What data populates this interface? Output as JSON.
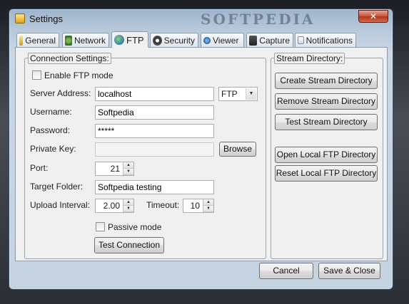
{
  "window": {
    "title": "Settings",
    "watermark": "SOFTPEDIA",
    "close_glyph": "✕"
  },
  "tabs": [
    {
      "label": "General",
      "icon": "general-icon"
    },
    {
      "label": "Network",
      "icon": "network-icon"
    },
    {
      "label": "FTP",
      "icon": "ftp-globe-icon",
      "active": true
    },
    {
      "label": "Security",
      "icon": "shield-icon"
    },
    {
      "label": "Viewer",
      "icon": "viewer-icon"
    },
    {
      "label": "Capture",
      "icon": "capture-icon"
    },
    {
      "label": "Notifications",
      "icon": "notifications-icon"
    }
  ],
  "connection": {
    "group_label": "Connection Settings:",
    "enable_ftp_label": "Enable FTP mode",
    "server_label": "Server Address:",
    "server_value": "localhost",
    "protocol_value": "FTP",
    "username_label": "Username:",
    "username_value": "Softpedia",
    "password_label": "Password:",
    "password_value": "*****",
    "private_key_label": "Private Key:",
    "private_key_value": "",
    "browse_label": "Browse",
    "port_label": "Port:",
    "port_value": "21",
    "target_label": "Target Folder:",
    "target_value": "Softpedia testing",
    "upload_label": "Upload Interval:",
    "upload_value": "2.00",
    "timeout_label": "Timeout:",
    "timeout_value": "10",
    "passive_label": "Passive mode",
    "test_label": "Test Connection"
  },
  "stream": {
    "group_label": "Stream Directory:",
    "create_label": "Create Stream Directory",
    "remove_label": "Remove Stream Directory",
    "test_label": "Test Stream Directory",
    "open_local_label": "Open Local FTP Directory",
    "reset_local_label": "Reset Local FTP Directory"
  },
  "footer": {
    "cancel_label": "Cancel",
    "save_label": "Save & Close"
  },
  "colors": {
    "title_gradient_top": "#9eb4cc",
    "close_red": "#c75139",
    "panel_bg": "#f0f0f0"
  }
}
